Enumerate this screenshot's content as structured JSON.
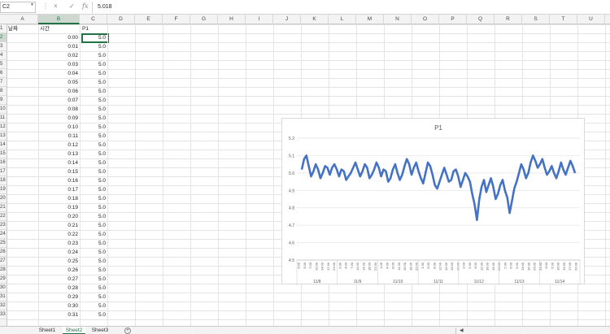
{
  "formula_bar": {
    "name_box": "C2",
    "formula_value": "5.018",
    "cancel_icon": "×",
    "confirm_icon": "✓",
    "fx_label": "fx"
  },
  "columns": [
    "A",
    "B",
    "C",
    "D",
    "E",
    "F",
    "G",
    "H",
    "I",
    "J",
    "K",
    "L",
    "M",
    "N",
    "O",
    "P",
    "Q",
    "R",
    "S",
    "T",
    "U"
  ],
  "selected_column": "B",
  "rows": [
    "1",
    "2",
    "3",
    "4",
    "5",
    "6",
    "7",
    "8",
    "9",
    "10",
    "11",
    "12",
    "13",
    "14",
    "15",
    "16",
    "17",
    "18",
    "19",
    "20",
    "21",
    "22",
    "23",
    "24",
    "25",
    "26",
    "27",
    "28",
    "29",
    "30",
    "31",
    "32",
    "33"
  ],
  "selected_row": "2",
  "headers": {
    "a1": "날짜",
    "b1": "시간",
    "c1": "P1"
  },
  "data_rows": [
    {
      "time": "0:00",
      "p1": "5.0"
    },
    {
      "time": "0:01",
      "p1": "5.0"
    },
    {
      "time": "0:02",
      "p1": "5.0"
    },
    {
      "time": "0:03",
      "p1": "5.0"
    },
    {
      "time": "0:04",
      "p1": "5.0"
    },
    {
      "time": "0:05",
      "p1": "5.0"
    },
    {
      "time": "0:06",
      "p1": "5.0"
    },
    {
      "time": "0:07",
      "p1": "5.0"
    },
    {
      "time": "0:08",
      "p1": "5.0"
    },
    {
      "time": "0:09",
      "p1": "5.0"
    },
    {
      "time": "0:10",
      "p1": "5.0"
    },
    {
      "time": "0:11",
      "p1": "5.0"
    },
    {
      "time": "0:12",
      "p1": "5.0"
    },
    {
      "time": "0:13",
      "p1": "5.0"
    },
    {
      "time": "0:14",
      "p1": "5.0"
    },
    {
      "time": "0:15",
      "p1": "5.0"
    },
    {
      "time": "0:16",
      "p1": "5.0"
    },
    {
      "time": "0:17",
      "p1": "5.0"
    },
    {
      "time": "0:18",
      "p1": "5.0"
    },
    {
      "time": "0:19",
      "p1": "5.0"
    },
    {
      "time": "0:20",
      "p1": "5.0"
    },
    {
      "time": "0:21",
      "p1": "5.0"
    },
    {
      "time": "0:22",
      "p1": "5.0"
    },
    {
      "time": "0:23",
      "p1": "5.0"
    },
    {
      "time": "0:24",
      "p1": "5.0"
    },
    {
      "time": "0:25",
      "p1": "5.0"
    },
    {
      "time": "0:26",
      "p1": "5.0"
    },
    {
      "time": "0:27",
      "p1": "5.0"
    },
    {
      "time": "0:28",
      "p1": "5.0"
    },
    {
      "time": "0:29",
      "p1": "5.0"
    },
    {
      "time": "0:30",
      "p1": "5.0"
    },
    {
      "time": "0:31",
      "p1": "5.0"
    }
  ],
  "sheet_tabs": [
    "Sheet1",
    "Sheet2",
    "Sheet3"
  ],
  "active_sheet": "Sheet2",
  "colors": {
    "accent": "#217346",
    "series": "#4472C4"
  },
  "chart_data": {
    "type": "line",
    "title": "P1",
    "xlabel": "",
    "ylabel": "",
    "ylim": [
      4.5,
      5.2
    ],
    "yticks": [
      "4.5",
      "4.6",
      "4.7",
      "4.8",
      "4.9",
      "5.0",
      "5.1",
      "5.2"
    ],
    "grid": true,
    "legend": "none",
    "date_labels": [
      "11/8",
      "11/9",
      "11/10",
      "11/11",
      "11/12",
      "11/13",
      "11/14"
    ],
    "time_tick_labels": [
      "0:00",
      "3:30",
      "7:00",
      "10:30",
      "14:00",
      "17:30",
      "21:00",
      "0:30",
      "4:00",
      "7:30",
      "11:00",
      "14:30",
      "18:00",
      "21:30",
      "1:00",
      "4:30",
      "8:00",
      "11:30",
      "15:00",
      "18:30",
      "22:00",
      "1:30",
      "5:00",
      "8:30",
      "12:00",
      "15:30",
      "19:00",
      "22:30",
      "2:00",
      "5:30",
      "9:00",
      "12:30",
      "16:00",
      "19:30",
      "23:00",
      "2:30",
      "6:00",
      "9:30",
      "13:00",
      "16:30",
      "20:00",
      "23:30",
      "3:00",
      "6:30",
      "10:00",
      "13:30",
      "17:00",
      "20:30"
    ],
    "series": [
      {
        "values": [
          5.02,
          5.08,
          5.1,
          5.04,
          4.98,
          5.01,
          5.05,
          5.02,
          4.97,
          5.0,
          5.04,
          5.03,
          4.99,
          5.03,
          5.05,
          5.02,
          4.98,
          5.02,
          5.01,
          4.96,
          4.98,
          5.0,
          5.03,
          5.06,
          5.02,
          4.98,
          5.01,
          5.05,
          5.03,
          4.97,
          4.99,
          5.02,
          5.06,
          5.03,
          4.98,
          5.02,
          5.01,
          4.95,
          4.97,
          5.02,
          5.05,
          5.0,
          4.96,
          4.99,
          5.04,
          5.08,
          5.05,
          4.99,
          5.03,
          5.06,
          5.01,
          4.97,
          4.94,
          5.0,
          5.06,
          5.04,
          4.99,
          4.93,
          4.91,
          4.95,
          4.99,
          5.03,
          4.99,
          4.95,
          4.96,
          5.01,
          5.02,
          4.98,
          4.92,
          4.96,
          5.0,
          4.98,
          4.95,
          4.88,
          4.82,
          4.73,
          4.85,
          4.92,
          4.96,
          4.89,
          4.93,
          4.97,
          4.92,
          4.85,
          4.88,
          4.93,
          4.96,
          4.9,
          4.86,
          4.77,
          4.84,
          4.91,
          4.95,
          5.0,
          5.05,
          5.02,
          4.97,
          5.0,
          5.06,
          5.1,
          5.07,
          5.03,
          5.05,
          5.08,
          5.03,
          4.99,
          5.01,
          5.04,
          5.0,
          4.97,
          5.01,
          5.06,
          5.02,
          4.99,
          5.03,
          5.07,
          5.04,
          5.0
        ]
      }
    ]
  }
}
